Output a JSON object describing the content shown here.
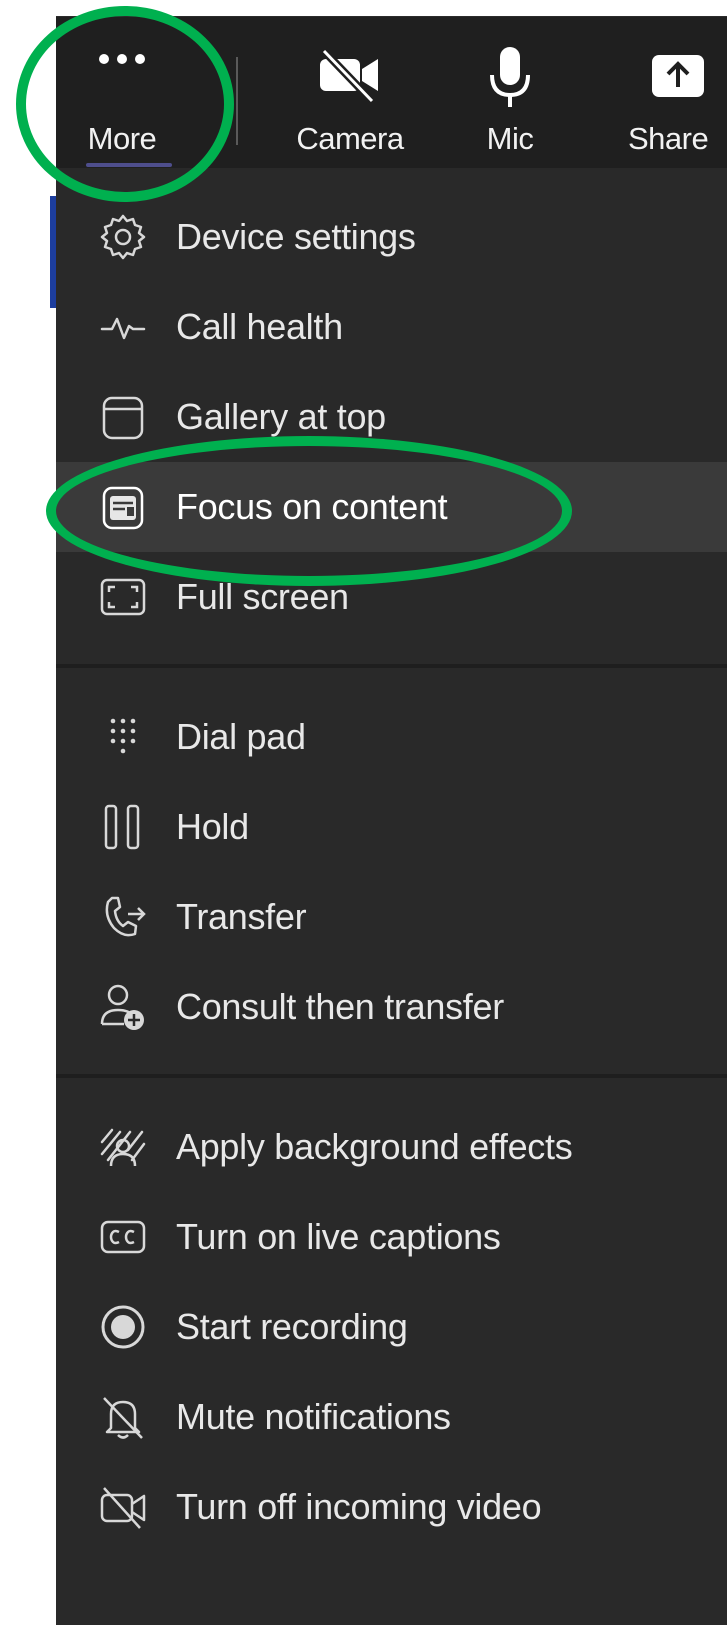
{
  "toolbar": {
    "more_label": "More",
    "camera_label": "Camera",
    "mic_label": "Mic",
    "share_label": "Share"
  },
  "menu": {
    "groups": [
      {
        "items": [
          {
            "label": "Device settings",
            "icon": "gear-icon"
          },
          {
            "label": "Call health",
            "icon": "pulse-icon"
          },
          {
            "label": "Gallery at top",
            "icon": "gallery-icon"
          },
          {
            "label": "Focus on content",
            "icon": "focus-icon",
            "highlighted": true
          },
          {
            "label": "Full screen",
            "icon": "fullscreen-icon"
          }
        ]
      },
      {
        "items": [
          {
            "label": "Dial pad",
            "icon": "dialpad-icon"
          },
          {
            "label": "Hold",
            "icon": "pause-icon"
          },
          {
            "label": "Transfer",
            "icon": "transfer-icon"
          },
          {
            "label": "Consult then transfer",
            "icon": "consult-icon"
          }
        ]
      },
      {
        "items": [
          {
            "label": "Apply background effects",
            "icon": "background-effects-icon"
          },
          {
            "label": "Turn on live captions",
            "icon": "captions-icon"
          },
          {
            "label": "Start recording",
            "icon": "record-icon"
          },
          {
            "label": "Mute notifications",
            "icon": "bell-off-icon"
          },
          {
            "label": "Turn off incoming video",
            "icon": "video-off-icon"
          }
        ]
      }
    ]
  },
  "colors": {
    "toolbar_bg": "#1f1f1f",
    "menu_bg": "#292929",
    "highlight_bg": "#3a3a3a",
    "annotation_ring": "#00b04f",
    "text": "#e8e8e8"
  }
}
